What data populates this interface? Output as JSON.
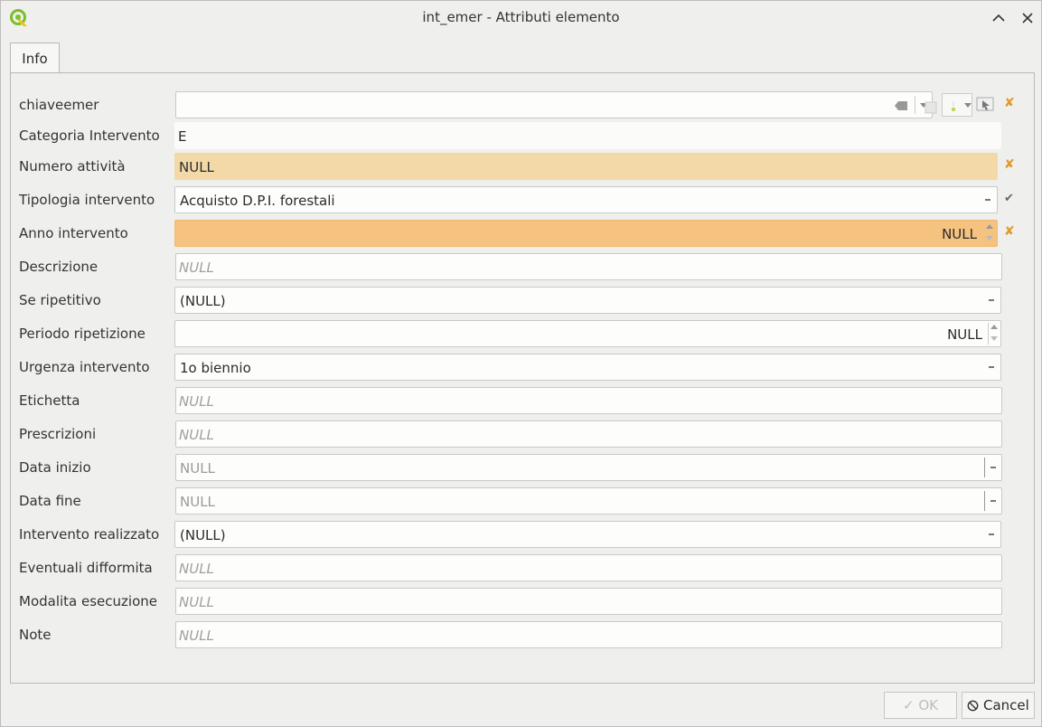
{
  "window": {
    "title": "int_emer - Attributi elemento",
    "app_icon": "qgis-logo-icon"
  },
  "tabs": [
    {
      "label": "Info"
    }
  ],
  "fields": {
    "chiaveemer": {
      "label": "chiaveemer",
      "value": ""
    },
    "categoria_intervento": {
      "label": "Categoria Intervento",
      "value": "E"
    },
    "numero_attivita": {
      "label": "Numero attività",
      "value": "NULL"
    },
    "tipologia_intervento": {
      "label": "Tipologia intervento",
      "value": "Acquisto D.P.I. forestali"
    },
    "anno_intervento": {
      "label": "Anno intervento",
      "value": "NULL"
    },
    "descrizione": {
      "label": "Descrizione",
      "value": "NULL"
    },
    "se_ripetitivo": {
      "label": "Se ripetitivo",
      "value": "(NULL)"
    },
    "periodo_ripetizione": {
      "label": "Periodo ripetizione",
      "value": "NULL"
    },
    "urgenza_intervento": {
      "label": "Urgenza intervento",
      "value": "1o biennio"
    },
    "etichetta": {
      "label": "Etichetta",
      "value": "NULL"
    },
    "prescrizioni": {
      "label": "Prescrizioni",
      "value": "NULL"
    },
    "data_inizio": {
      "label": "Data inizio",
      "value": "NULL"
    },
    "data_fine": {
      "label": "Data fine",
      "value": "NULL"
    },
    "intervento_realizzato": {
      "label": "Intervento realizzato",
      "value": "(NULL)"
    },
    "eventuali_difformita": {
      "label": "Eventuali difformita",
      "value": "NULL"
    },
    "modalita_esecuzione": {
      "label": "Modalita esecuzione",
      "value": "NULL"
    },
    "note": {
      "label": "Note",
      "value": "NULL"
    }
  },
  "buttons": {
    "ok": "OK",
    "cancel": "Cancel"
  },
  "colors": {
    "constraint_warning": "#f5c27f",
    "not_null_bg": "#f3d9a8",
    "warning_icon": "#e09a2a"
  }
}
